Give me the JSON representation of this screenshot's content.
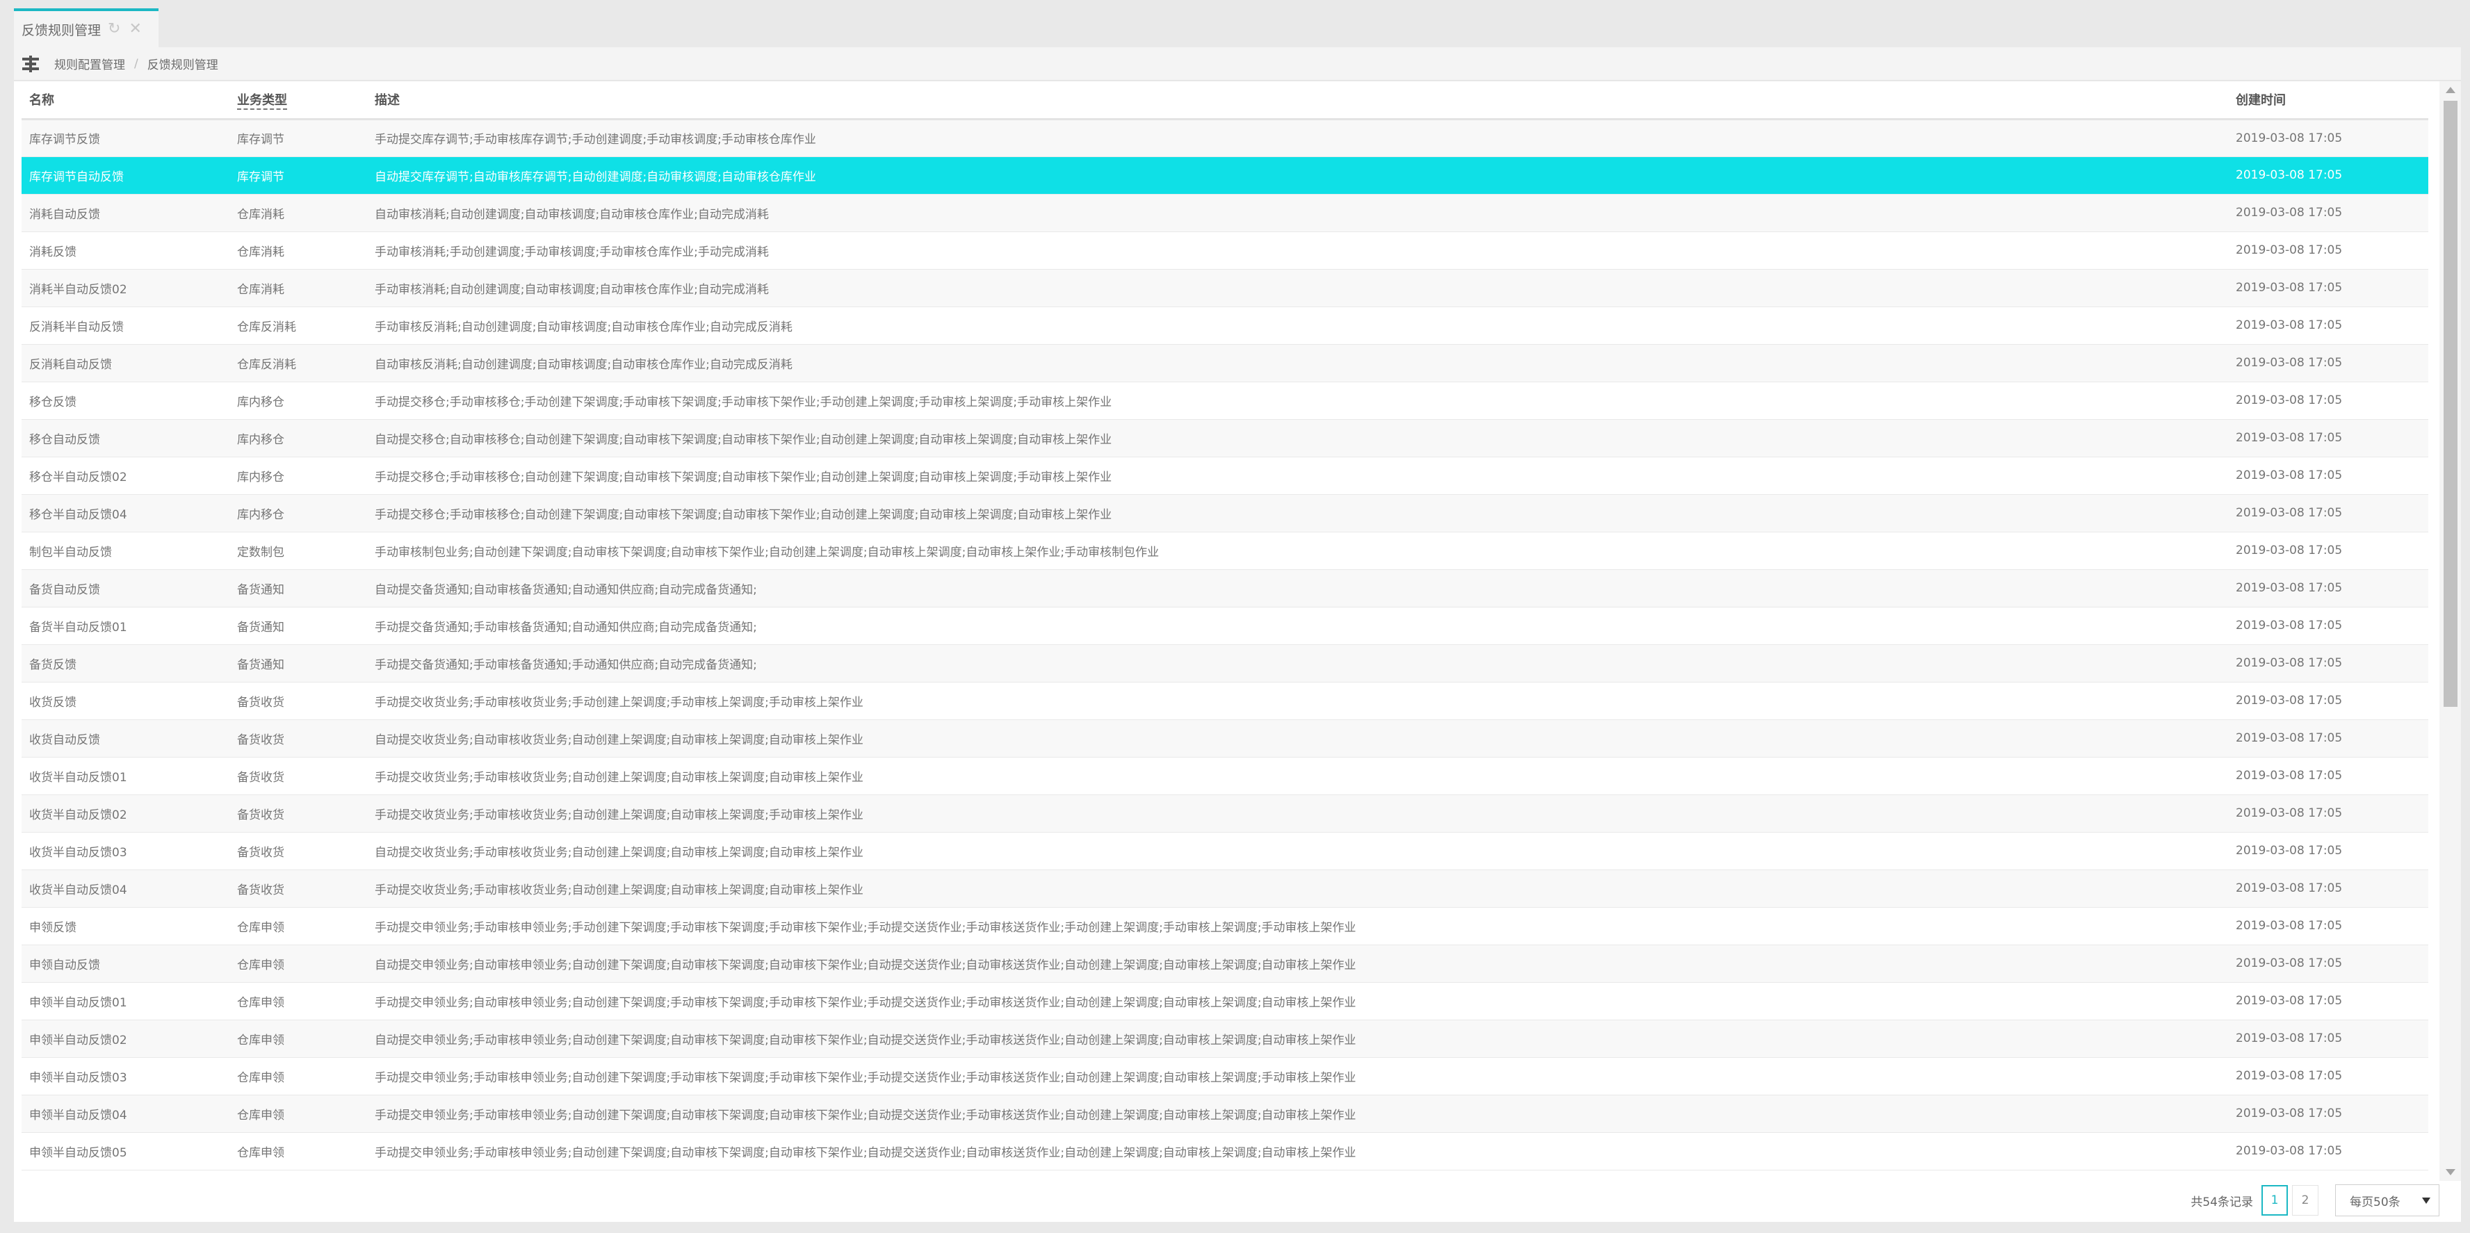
{
  "tab": {
    "label": "反馈规则管理",
    "refresh_icon": "refresh-icon",
    "close_icon": "close-icon"
  },
  "breadcrumb": {
    "icon": "sitemap-icon",
    "items": [
      "规则配置管理",
      "反馈规则管理"
    ],
    "separator": "/"
  },
  "table": {
    "columns": [
      "名称",
      "业务类型",
      "描述",
      "创建时间"
    ],
    "selected_row": 1,
    "rows": [
      {
        "name": "库存调节反馈",
        "type": "库存调节",
        "desc": "手动提交库存调节;手动审核库存调节;手动创建调度;手动审核调度;手动审核仓库作业",
        "time": "2019-03-08 17:05"
      },
      {
        "name": "库存调节自动反馈",
        "type": "库存调节",
        "desc": "自动提交库存调节;自动审核库存调节;自动创建调度;自动审核调度;自动审核仓库作业",
        "time": "2019-03-08 17:05"
      },
      {
        "name": "消耗自动反馈",
        "type": "仓库消耗",
        "desc": "自动审核消耗;自动创建调度;自动审核调度;自动审核仓库作业;自动完成消耗",
        "time": "2019-03-08 17:05"
      },
      {
        "name": "消耗反馈",
        "type": "仓库消耗",
        "desc": "手动审核消耗;手动创建调度;手动审核调度;手动审核仓库作业;手动完成消耗",
        "time": "2019-03-08 17:05"
      },
      {
        "name": "消耗半自动反馈02",
        "type": "仓库消耗",
        "desc": "手动审核消耗;自动创建调度;自动审核调度;自动审核仓库作业;自动完成消耗",
        "time": "2019-03-08 17:05"
      },
      {
        "name": "反消耗半自动反馈",
        "type": "仓库反消耗",
        "desc": "手动审核反消耗;自动创建调度;自动审核调度;自动审核仓库作业;自动完成反消耗",
        "time": "2019-03-08 17:05"
      },
      {
        "name": "反消耗自动反馈",
        "type": "仓库反消耗",
        "desc": "自动审核反消耗;自动创建调度;自动审核调度;自动审核仓库作业;自动完成反消耗",
        "time": "2019-03-08 17:05"
      },
      {
        "name": "移仓反馈",
        "type": "库内移仓",
        "desc": "手动提交移仓;手动审核移仓;手动创建下架调度;手动审核下架调度;手动审核下架作业;手动创建上架调度;手动审核上架调度;手动审核上架作业",
        "time": "2019-03-08 17:05"
      },
      {
        "name": "移仓自动反馈",
        "type": "库内移仓",
        "desc": "自动提交移仓;自动审核移仓;自动创建下架调度;自动审核下架调度;自动审核下架作业;自动创建上架调度;自动审核上架调度;自动审核上架作业",
        "time": "2019-03-08 17:05"
      },
      {
        "name": "移仓半自动反馈02",
        "type": "库内移仓",
        "desc": "手动提交移仓;手动审核移仓;自动创建下架调度;自动审核下架调度;自动审核下架作业;自动创建上架调度;自动审核上架调度;手动审核上架作业",
        "time": "2019-03-08 17:05"
      },
      {
        "name": "移仓半自动反馈04",
        "type": "库内移仓",
        "desc": "手动提交移仓;手动审核移仓;自动创建下架调度;自动审核下架调度;自动审核下架作业;自动创建上架调度;自动审核上架调度;自动审核上架作业",
        "time": "2019-03-08 17:05"
      },
      {
        "name": "制包半自动反馈",
        "type": "定数制包",
        "desc": "手动审核制包业务;自动创建下架调度;自动审核下架调度;自动审核下架作业;自动创建上架调度;自动审核上架调度;自动审核上架作业;手动审核制包作业",
        "time": "2019-03-08 17:05"
      },
      {
        "name": "备货自动反馈",
        "type": "备货通知",
        "desc": "自动提交备货通知;自动审核备货通知;自动通知供应商;自动完成备货通知;",
        "time": "2019-03-08 17:05"
      },
      {
        "name": "备货半自动反馈01",
        "type": "备货通知",
        "desc": "手动提交备货通知;手动审核备货通知;自动通知供应商;自动完成备货通知;",
        "time": "2019-03-08 17:05"
      },
      {
        "name": "备货反馈",
        "type": "备货通知",
        "desc": "手动提交备货通知;手动审核备货通知;手动通知供应商;自动完成备货通知;",
        "time": "2019-03-08 17:05"
      },
      {
        "name": "收货反馈",
        "type": "备货收货",
        "desc": "手动提交收货业务;手动审核收货业务;手动创建上架调度;手动审核上架调度;手动审核上架作业",
        "time": "2019-03-08 17:05"
      },
      {
        "name": "收货自动反馈",
        "type": "备货收货",
        "desc": "自动提交收货业务;自动审核收货业务;自动创建上架调度;自动审核上架调度;自动审核上架作业",
        "time": "2019-03-08 17:05"
      },
      {
        "name": "收货半自动反馈01",
        "type": "备货收货",
        "desc": "手动提交收货业务;手动审核收货业务;自动创建上架调度;自动审核上架调度;自动审核上架作业",
        "time": "2019-03-08 17:05"
      },
      {
        "name": "收货半自动反馈02",
        "type": "备货收货",
        "desc": "手动提交收货业务;手动审核收货业务;自动创建上架调度;自动审核上架调度;手动审核上架作业",
        "time": "2019-03-08 17:05"
      },
      {
        "name": "收货半自动反馈03",
        "type": "备货收货",
        "desc": "自动提交收货业务;手动审核收货业务;自动创建上架调度;自动审核上架调度;自动审核上架作业",
        "time": "2019-03-08 17:05"
      },
      {
        "name": "收货半自动反馈04",
        "type": "备货收货",
        "desc": "手动提交收货业务;手动审核收货业务;自动创建上架调度;自动审核上架调度;自动审核上架作业",
        "time": "2019-03-08 17:05"
      },
      {
        "name": "申领反馈",
        "type": "仓库申领",
        "desc": "手动提交申领业务;手动审核申领业务;手动创建下架调度;手动审核下架调度;手动审核下架作业;手动提交送货作业;手动审核送货作业;手动创建上架调度;手动审核上架调度;手动审核上架作业",
        "time": "2019-03-08 17:05"
      },
      {
        "name": "申领自动反馈",
        "type": "仓库申领",
        "desc": "自动提交申领业务;自动审核申领业务;自动创建下架调度;自动审核下架调度;自动审核下架作业;自动提交送货作业;自动审核送货作业;自动创建上架调度;自动审核上架调度;自动审核上架作业",
        "time": "2019-03-08 17:05"
      },
      {
        "name": "申领半自动反馈01",
        "type": "仓库申领",
        "desc": "手动提交申领业务;自动审核申领业务;自动创建下架调度;手动审核下架调度;手动审核下架作业;手动提交送货作业;手动审核送货作业;自动创建上架调度;自动审核上架调度;自动审核上架作业",
        "time": "2019-03-08 17:05"
      },
      {
        "name": "申领半自动反馈02",
        "type": "仓库申领",
        "desc": "自动提交申领业务;手动审核申领业务;自动创建下架调度;自动审核下架调度;自动审核下架作业;自动提交送货作业;手动审核送货作业;自动创建上架调度;自动审核上架调度;自动审核上架作业",
        "time": "2019-03-08 17:05"
      },
      {
        "name": "申领半自动反馈03",
        "type": "仓库申领",
        "desc": "手动提交申领业务;手动审核申领业务;自动创建下架调度;手动审核下架调度;手动审核下架作业;手动提交送货作业;手动审核送货作业;自动创建上架调度;自动审核上架调度;手动审核上架作业",
        "time": "2019-03-08 17:05"
      },
      {
        "name": "申领半自动反馈04",
        "type": "仓库申领",
        "desc": "手动提交申领业务;手动审核申领业务;自动创建下架调度;自动审核下架调度;自动审核下架作业;自动提交送货作业;手动审核送货作业;自动创建上架调度;自动审核上架调度;自动审核上架作业",
        "time": "2019-03-08 17:05"
      },
      {
        "name": "申领半自动反馈05",
        "type": "仓库申领",
        "desc": "手动提交申领业务;手动审核申领业务;自动创建下架调度;自动审核下架调度;自动审核下架作业;自动提交送货作业;自动审核送货作业;自动创建上架调度;自动审核上架调度;自动审核上架作业",
        "time": "2019-03-08 17:05"
      }
    ]
  },
  "pagination": {
    "total": "共54条记录",
    "pages": [
      "1",
      "2"
    ],
    "current": "1",
    "page_size": "每页50条"
  },
  "colors": {
    "accent": "#1cb8c4",
    "selected_row": "#0fe0e6"
  }
}
